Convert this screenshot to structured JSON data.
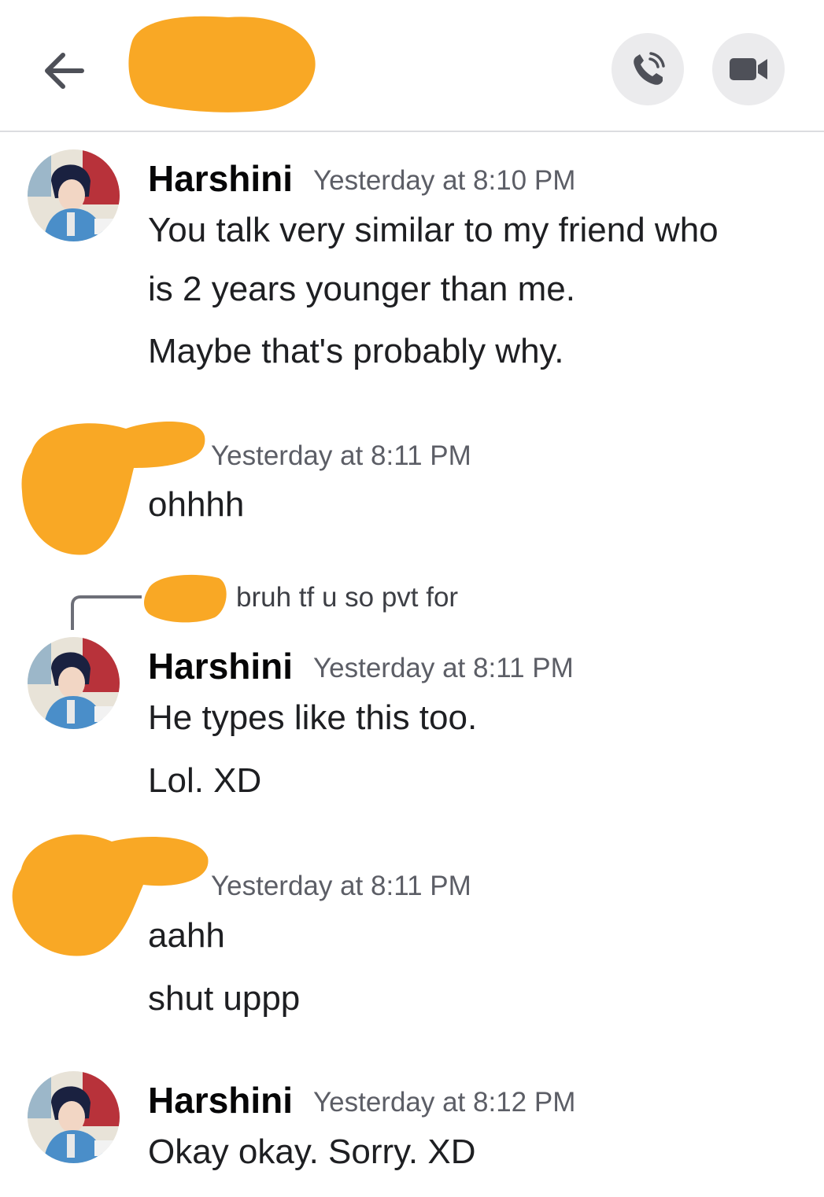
{
  "header": {
    "back_icon": "arrow-left-icon",
    "call_icon": "phone-icon",
    "video_icon": "video-camera-icon",
    "redaction_color": "#f9a825"
  },
  "messages": [
    {
      "author": "Harshini",
      "time": "Yesterday at 8:10 PM",
      "lines": [
        "You talk very similar to my friend who",
        "is 2 years younger than me.",
        "Maybe that's probably why."
      ]
    },
    {
      "author": "",
      "time": "Yesterday at 8:11 PM",
      "lines": [
        "ohhhh"
      ]
    },
    {
      "reply_preview": "bruh tf u so pvt for",
      "author": "Harshini",
      "time": "Yesterday at 8:11 PM",
      "lines": [
        "He types like this too.",
        "Lol. XD"
      ]
    },
    {
      "author": "",
      "time": "Yesterday at 8:11 PM",
      "lines": [
        "aahh",
        "shut uppp"
      ]
    },
    {
      "author": "Harshini",
      "time": "Yesterday at 8:12 PM",
      "lines": [
        "Okay okay. Sorry. XD"
      ]
    }
  ],
  "colors": {
    "accent_redaction": "#f9a825",
    "timestamp": "#5c5e66",
    "divider": "#dcdde0"
  }
}
